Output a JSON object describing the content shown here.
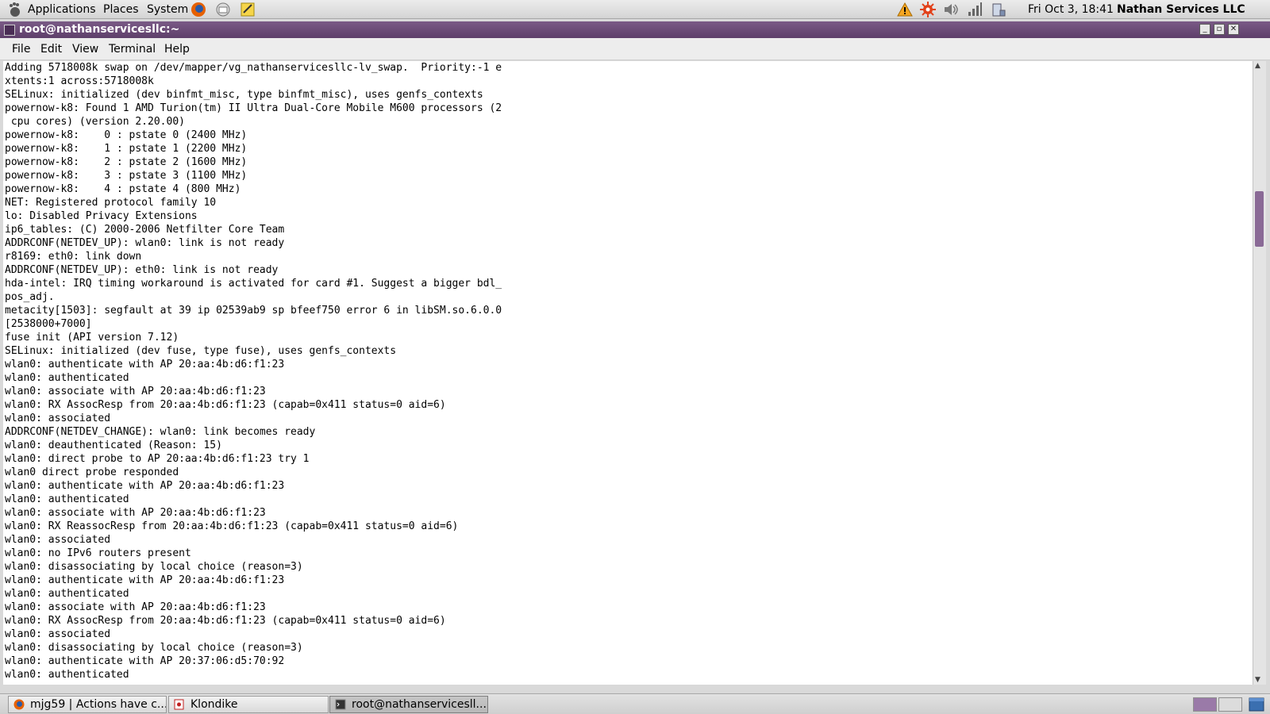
{
  "top_panel": {
    "menus": [
      "Applications",
      "Places",
      "System"
    ],
    "clock": "Fri Oct  3, 18:41",
    "user": "Nathan Services LLC"
  },
  "window": {
    "title": "root@nathanservicesllc:~",
    "menus": [
      "File",
      "Edit",
      "View",
      "Terminal",
      "Help"
    ]
  },
  "terminal": {
    "lines": [
      "Adding 5718008k swap on /dev/mapper/vg_nathanservicesllc-lv_swap.  Priority:-1 e",
      "xtents:1 across:5718008k",
      "SELinux: initialized (dev binfmt_misc, type binfmt_misc), uses genfs_contexts",
      "powernow-k8: Found 1 AMD Turion(tm) II Ultra Dual-Core Mobile M600 processors (2",
      " cpu cores) (version 2.20.00)",
      "powernow-k8:    0 : pstate 0 (2400 MHz)",
      "powernow-k8:    1 : pstate 1 (2200 MHz)",
      "powernow-k8:    2 : pstate 2 (1600 MHz)",
      "powernow-k8:    3 : pstate 3 (1100 MHz)",
      "powernow-k8:    4 : pstate 4 (800 MHz)",
      "NET: Registered protocol family 10",
      "lo: Disabled Privacy Extensions",
      "ip6_tables: (C) 2000-2006 Netfilter Core Team",
      "ADDRCONF(NETDEV_UP): wlan0: link is not ready",
      "r8169: eth0: link down",
      "ADDRCONF(NETDEV_UP): eth0: link is not ready",
      "hda-intel: IRQ timing workaround is activated for card #1. Suggest a bigger bdl_",
      "pos_adj.",
      "metacity[1503]: segfault at 39 ip 02539ab9 sp bfeef750 error 6 in libSM.so.6.0.0",
      "[2538000+7000]",
      "fuse init (API version 7.12)",
      "SELinux: initialized (dev fuse, type fuse), uses genfs_contexts",
      "wlan0: authenticate with AP 20:aa:4b:d6:f1:23",
      "wlan0: authenticated",
      "wlan0: associate with AP 20:aa:4b:d6:f1:23",
      "wlan0: RX AssocResp from 20:aa:4b:d6:f1:23 (capab=0x411 status=0 aid=6)",
      "wlan0: associated",
      "ADDRCONF(NETDEV_CHANGE): wlan0: link becomes ready",
      "wlan0: deauthenticated (Reason: 15)",
      "wlan0: direct probe to AP 20:aa:4b:d6:f1:23 try 1",
      "wlan0 direct probe responded",
      "wlan0: authenticate with AP 20:aa:4b:d6:f1:23",
      "wlan0: authenticated",
      "wlan0: associate with AP 20:aa:4b:d6:f1:23",
      "wlan0: RX ReassocResp from 20:aa:4b:d6:f1:23 (capab=0x411 status=0 aid=6)",
      "wlan0: associated",
      "wlan0: no IPv6 routers present",
      "wlan0: disassociating by local choice (reason=3)",
      "wlan0: authenticate with AP 20:aa:4b:d6:f1:23",
      "wlan0: authenticated",
      "wlan0: associate with AP 20:aa:4b:d6:f1:23",
      "wlan0: RX AssocResp from 20:aa:4b:d6:f1:23 (capab=0x411 status=0 aid=6)",
      "wlan0: associated",
      "wlan0: disassociating by local choice (reason=3)",
      "wlan0: authenticate with AP 20:37:06:d5:70:92",
      "wlan0: authenticated"
    ]
  },
  "taskbar": {
    "items": [
      {
        "label": "mjg59 | Actions have c...",
        "icon": "firefox-icon",
        "active": false
      },
      {
        "label": "Klondike",
        "icon": "cards-icon",
        "active": false
      },
      {
        "label": "root@nathanservicesll...",
        "icon": "terminal-icon",
        "active": true
      }
    ]
  },
  "colors": {
    "title_bar": "#6b4c77",
    "scrollbar_thumb": "#8a6a96"
  }
}
